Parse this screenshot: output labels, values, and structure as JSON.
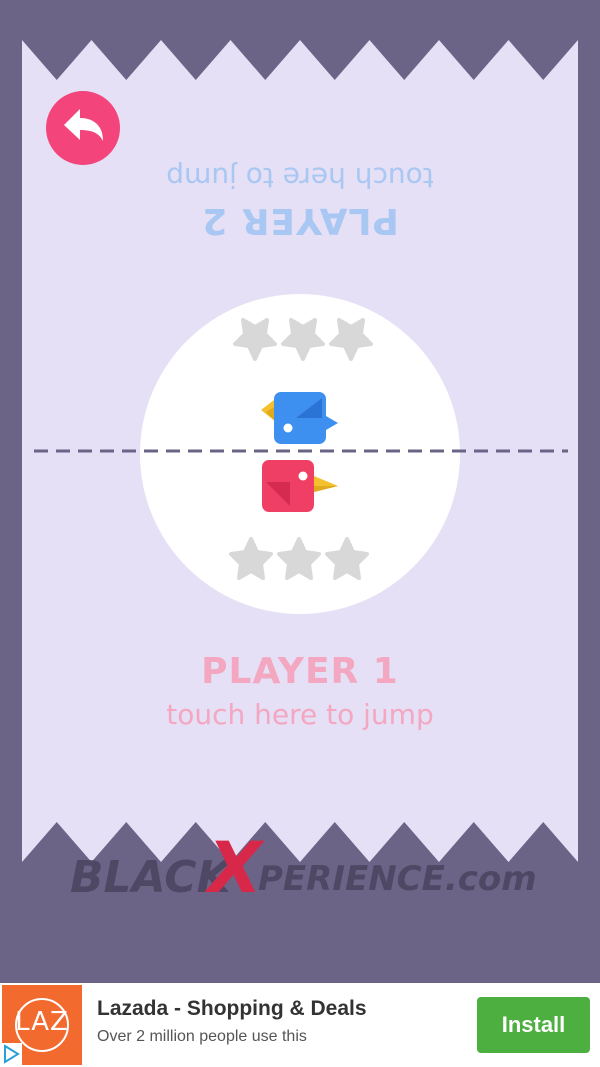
{
  "game": {
    "player2": {
      "name": "PLAYER 2",
      "hint": "touch here to jump",
      "stars_earned": 0,
      "stars_total": 3
    },
    "player1": {
      "name": "PLAYER 1",
      "hint": "touch here to jump",
      "stars_earned": 0,
      "stars_total": 3
    },
    "colors": {
      "player1_bird": "#ef3f64",
      "player2_bird": "#3d8ff0",
      "beak": "#f3c12e",
      "star_empty": "#d8d8d8",
      "back_button": "#f4447c"
    },
    "icons": {
      "back": "undo-arrow-icon"
    }
  },
  "watermark": {
    "text": "BLACKXPERIENCE.com"
  },
  "ad": {
    "logo_text": "LAZ",
    "title": "Lazada - Shopping & Deals",
    "subtitle": "Over 2 million people use this",
    "install_label": "Install",
    "button_color": "#4caf3f"
  }
}
